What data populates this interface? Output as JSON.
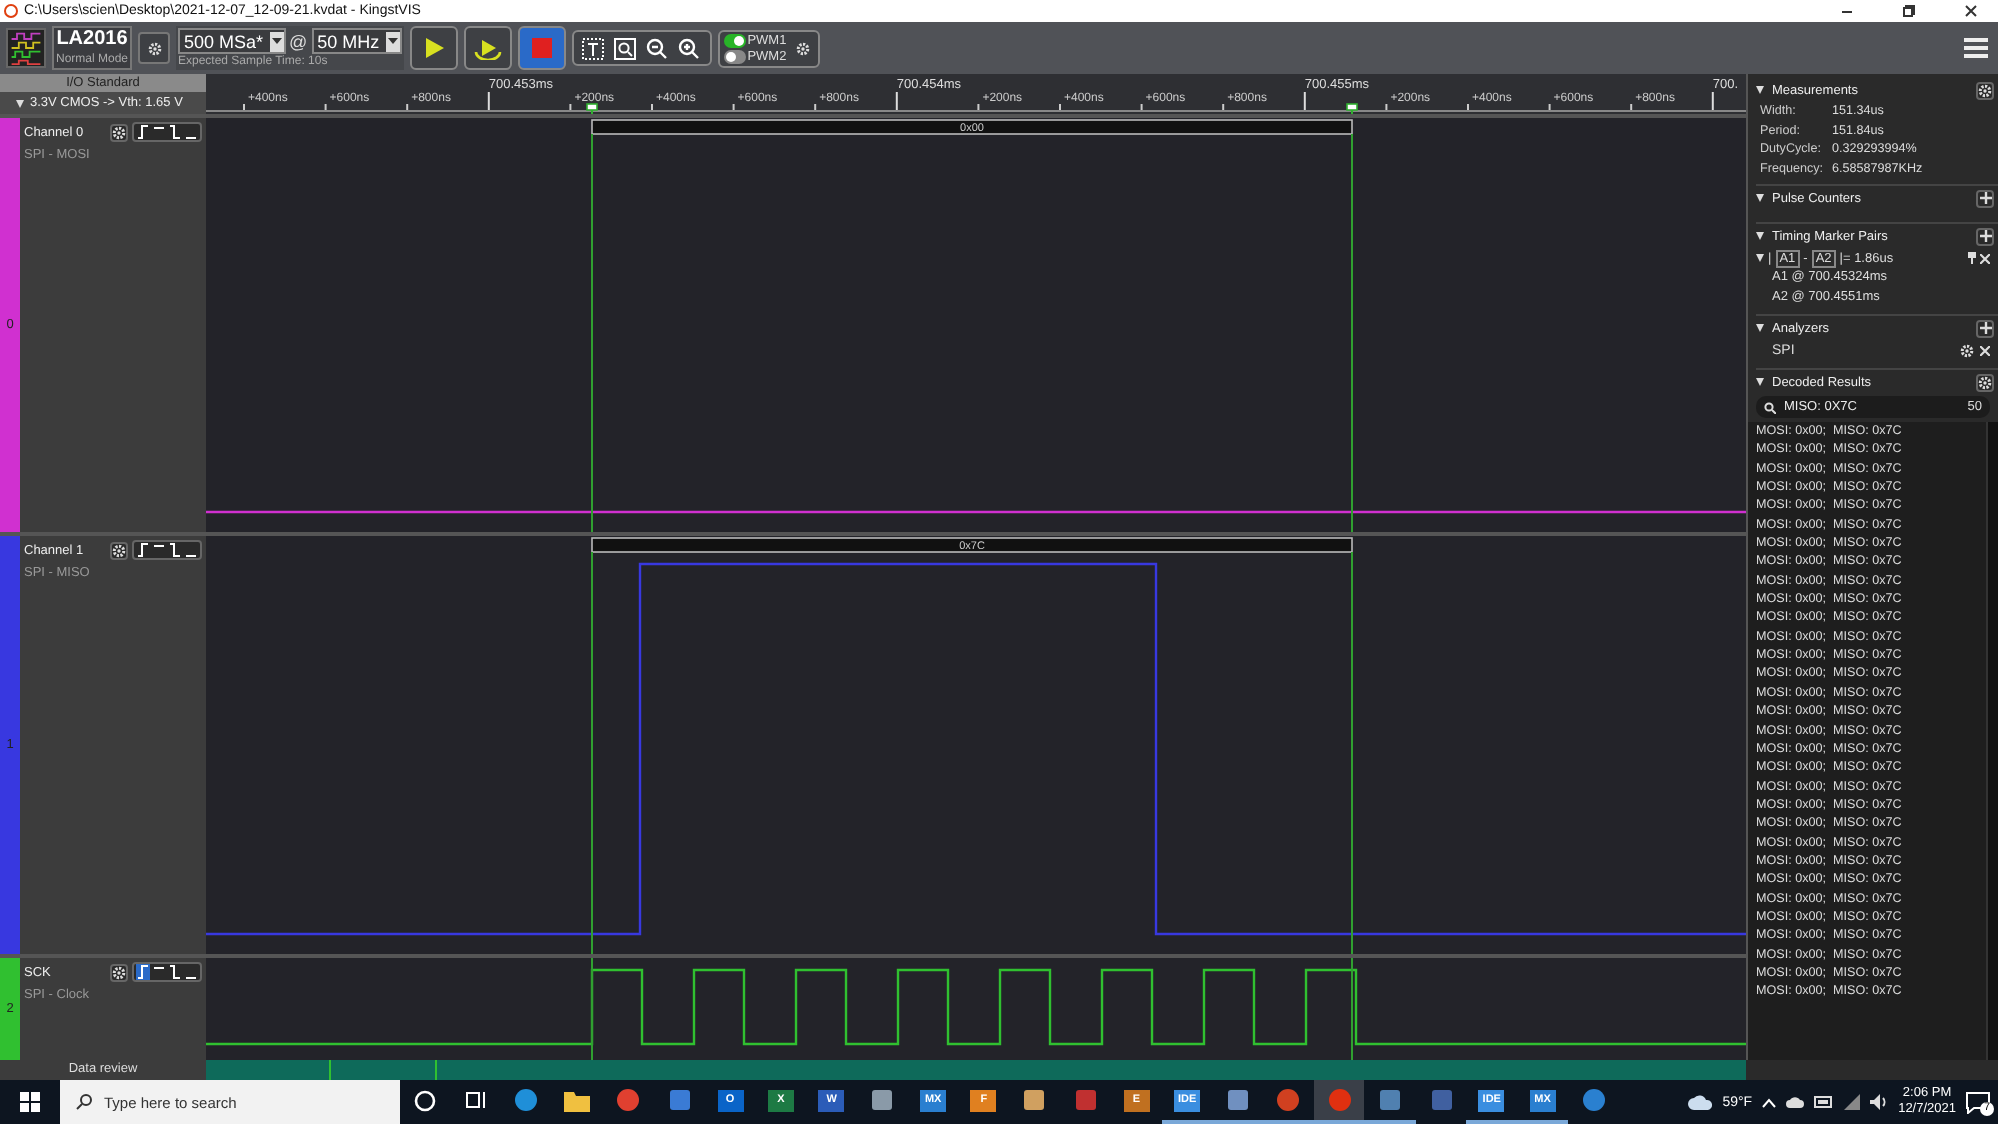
{
  "window": {
    "title": "C:\\Users\\scien\\Desktop\\2021-12-07_12-09-21.kvdat - KingstVIS"
  },
  "toolbar": {
    "device": "LA2016",
    "mode": "Normal Mode",
    "sample_depth": "500 MSa*",
    "at": "@",
    "sample_rate": "50 MHz",
    "expected_time": "Expected Sample Time: 10s",
    "pwm": [
      {
        "label": "PWM1",
        "on": true
      },
      {
        "label": "PWM2",
        "on": false
      }
    ]
  },
  "io_standard": {
    "title": "I/O Standard",
    "value": "3.3V CMOS -> Vth: 1.65 V"
  },
  "ruler": [
    {
      "label": "+400ns",
      "kind": "minor"
    },
    {
      "label": "+600ns",
      "kind": "minor"
    },
    {
      "label": "+800ns",
      "kind": "minor"
    },
    {
      "label": "700.453ms",
      "kind": "major"
    },
    {
      "label": "+200ns",
      "kind": "minor"
    },
    {
      "label": "+400ns",
      "kind": "minor"
    },
    {
      "label": "+600ns",
      "kind": "minor"
    },
    {
      "label": "+800ns",
      "kind": "minor"
    },
    {
      "label": "700.454ms",
      "kind": "major"
    },
    {
      "label": "+200ns",
      "kind": "minor"
    },
    {
      "label": "+400ns",
      "kind": "minor"
    },
    {
      "label": "+600ns",
      "kind": "minor"
    },
    {
      "label": "+800ns",
      "kind": "minor"
    },
    {
      "label": "700.455ms",
      "kind": "major"
    },
    {
      "label": "+200ns",
      "kind": "minor"
    },
    {
      "label": "+400ns",
      "kind": "minor"
    },
    {
      "label": "+600ns",
      "kind": "minor"
    },
    {
      "label": "+800ns",
      "kind": "minor"
    },
    {
      "label": "700.",
      "kind": "major"
    }
  ],
  "channels": [
    {
      "kind": "low",
      "name": "Channel 0",
      "protocol": "SPI - MOSI",
      "number": "0",
      "color": "#d030d0",
      "rising_trigger": false,
      "decoded": "0x00"
    },
    {
      "kind": "pulse",
      "name": "Channel 1",
      "protocol": "SPI - MISO",
      "number": "1",
      "color": "#3838e0",
      "rising_trigger": false,
      "decoded": "0x7C"
    },
    {
      "kind": "clock",
      "name": "SCK",
      "protocol": "SPI - Clock",
      "number": "2",
      "color": "#30c030",
      "rising_trigger": true
    }
  ],
  "data_review": {
    "label": "Data review"
  },
  "panel": {
    "measurements": {
      "title": "Measurements",
      "rows": [
        {
          "key": "Width:",
          "value": "151.34us"
        },
        {
          "key": "Period:",
          "value": "151.84us"
        },
        {
          "key": "DutyCycle:",
          "value": "0.329293994%"
        },
        {
          "key": "Frequency:",
          "value": "6.58587987KHz"
        }
      ]
    },
    "pulse_counters": {
      "title": "Pulse Counters"
    },
    "timing_markers": {
      "title": "Timing Marker Pairs",
      "pair": {
        "open": "|",
        "a": "A1",
        "dash": "-",
        "b": "A2",
        "value": "|= 1.86us"
      },
      "lines": [
        "A1 @ 700.45324ms",
        "A2 @ 700.4551ms"
      ]
    },
    "analyzers": {
      "title": "Analyzers",
      "items": [
        "SPI"
      ]
    },
    "decoded_results": {
      "title": "Decoded Results",
      "search": "MISO: 0X7C",
      "count": "50",
      "rows": [
        "MOSI: 0x00;  MISO: 0x7C",
        "MOSI: 0x00;  MISO: 0x7C",
        "MOSI: 0x00;  MISO: 0x7C",
        "MOSI: 0x00;  MISO: 0x7C",
        "MOSI: 0x00;  MISO: 0x7C",
        "MOSI: 0x00;  MISO: 0x7C",
        "MOSI: 0x00;  MISO: 0x7C",
        "MOSI: 0x00;  MISO: 0x7C",
        "MOSI: 0x00;  MISO: 0x7C",
        "MOSI: 0x00;  MISO: 0x7C",
        "MOSI: 0x00;  MISO: 0x7C",
        "MOSI: 0x00;  MISO: 0x7C",
        "MOSI: 0x00;  MISO: 0x7C",
        "MOSI: 0x00;  MISO: 0x7C",
        "MOSI: 0x00;  MISO: 0x7C",
        "MOSI: 0x00;  MISO: 0x7C",
        "MOSI: 0x00;  MISO: 0x7C",
        "MOSI: 0x00;  MISO: 0x7C",
        "MOSI: 0x00;  MISO: 0x7C",
        "MOSI: 0x00;  MISO: 0x7C",
        "MOSI: 0x00;  MISO: 0x7C",
        "MOSI: 0x00;  MISO: 0x7C",
        "MOSI: 0x00;  MISO: 0x7C",
        "MOSI: 0x00;  MISO: 0x7C",
        "MOSI: 0x00;  MISO: 0x7C",
        "MOSI: 0x00;  MISO: 0x7C",
        "MOSI: 0x00;  MISO: 0x7C",
        "MOSI: 0x00;  MISO: 0x7C",
        "MOSI: 0x00;  MISO: 0x7C",
        "MOSI: 0x00;  MISO: 0x7C",
        "MOSI: 0x00;  MISO: 0x7C"
      ]
    }
  },
  "taskbar": {
    "search_placeholder": "Type here to search",
    "apps": [
      {
        "kind": "circle",
        "running": false,
        "active": false
      },
      {
        "kind": "taskview",
        "running": false,
        "active": false
      },
      {
        "kind": "round",
        "color": "#1f8fd8",
        "running": false,
        "active": false
      },
      {
        "kind": "folder",
        "color": "#f0c040",
        "running": false,
        "active": false
      },
      {
        "kind": "round",
        "color": "#e04030",
        "running": false,
        "active": false
      },
      {
        "kind": "square",
        "color": "#3a7bd5",
        "running": false,
        "active": false
      },
      {
        "kind": "tile",
        "label": "O",
        "color": "#0a64c8",
        "running": false,
        "active": false
      },
      {
        "kind": "tile",
        "label": "X",
        "color": "#1d7a44",
        "running": false,
        "active": false
      },
      {
        "kind": "tile",
        "label": "W",
        "color": "#2b5cb8",
        "running": false,
        "active": false
      },
      {
        "kind": "square",
        "color": "#8a9aa8",
        "running": false,
        "active": false
      },
      {
        "kind": "tile",
        "label": "MX",
        "color": "#2a7fd0",
        "running": false,
        "active": false
      },
      {
        "kind": "tile",
        "label": "F",
        "color": "#e08020",
        "running": false,
        "active": false
      },
      {
        "kind": "square",
        "color": "#d0a060",
        "running": false,
        "active": false
      },
      {
        "kind": "square",
        "color": "#c03030",
        "running": false,
        "active": false
      },
      {
        "kind": "tile",
        "label": "E",
        "color": "#c07020",
        "running": false,
        "active": false
      },
      {
        "kind": "tile",
        "label": "IDE",
        "color": "#3a8ee0",
        "running": true,
        "active": false
      },
      {
        "kind": "square",
        "color": "#7090c0",
        "running": true,
        "active": false
      },
      {
        "kind": "round",
        "color": "#d04020",
        "running": true,
        "active": false
      },
      {
        "kind": "round",
        "color": "#e03010",
        "running": true,
        "active": true
      },
      {
        "kind": "square",
        "color": "#5080b0",
        "running": true,
        "active": false
      },
      {
        "kind": "square",
        "color": "#4060a0",
        "running": false,
        "active": false
      },
      {
        "kind": "tile",
        "label": "IDE",
        "color": "#3a8ee0",
        "running": true,
        "active": false
      },
      {
        "kind": "tile",
        "label": "MX",
        "color": "#2a7fd0",
        "running": true,
        "active": false
      },
      {
        "kind": "round",
        "color": "#2a80d0",
        "running": false,
        "active": false
      }
    ],
    "temperature": "59°F",
    "time": "2:06 PM",
    "date": "12/7/2021",
    "notifications": "7"
  }
}
